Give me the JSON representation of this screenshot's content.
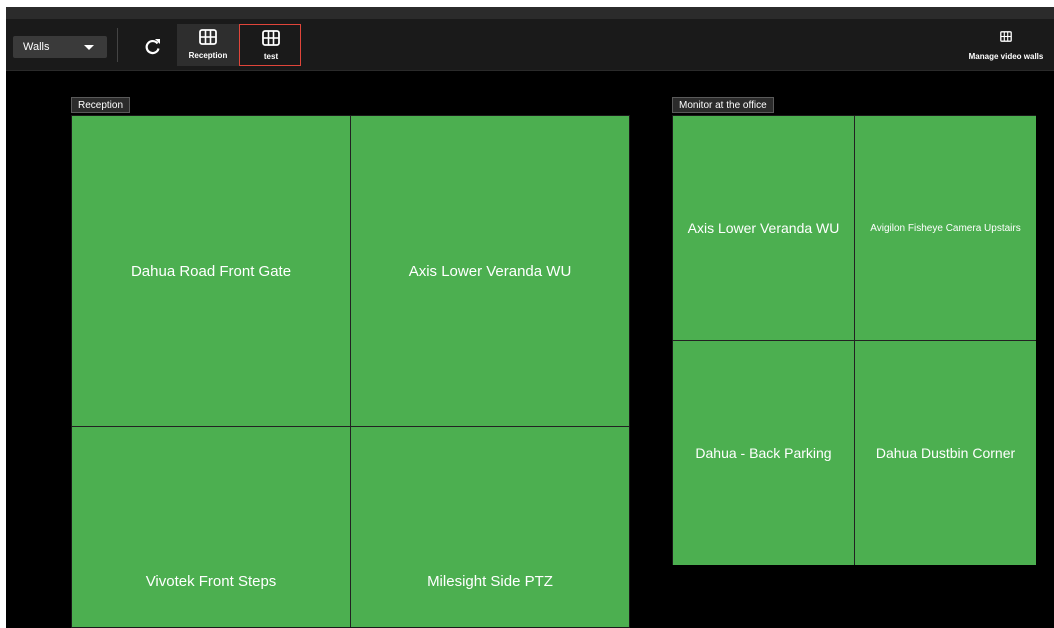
{
  "toolbar": {
    "walls_select_value": "Walls",
    "refresh_icon": "refresh-icon",
    "wall_buttons": [
      {
        "label": "Reception",
        "icon": "grid-icon"
      },
      {
        "label": "test",
        "icon": "grid-icon",
        "highlight_color": "#e0453a"
      }
    ],
    "manage_label": "Manage video walls",
    "manage_icon": "grid-icon"
  },
  "walls": [
    {
      "title": "Reception",
      "tiles": [
        "Dahua Road Front Gate",
        "Axis Lower Veranda WU",
        "Vivotek Front Steps",
        "Milesight Side PTZ"
      ]
    },
    {
      "title": "Monitor at the office",
      "tiles": [
        "Axis Lower Veranda WU",
        "Avigilon Fisheye Camera Upstairs",
        "Dahua - Back Parking",
        "Dahua Dustbin Corner"
      ]
    }
  ],
  "colors": {
    "tile_green": "#4caf50",
    "background": "#000000",
    "toolbar": "#1a1a1a",
    "selected_outline": "#e0453a"
  }
}
